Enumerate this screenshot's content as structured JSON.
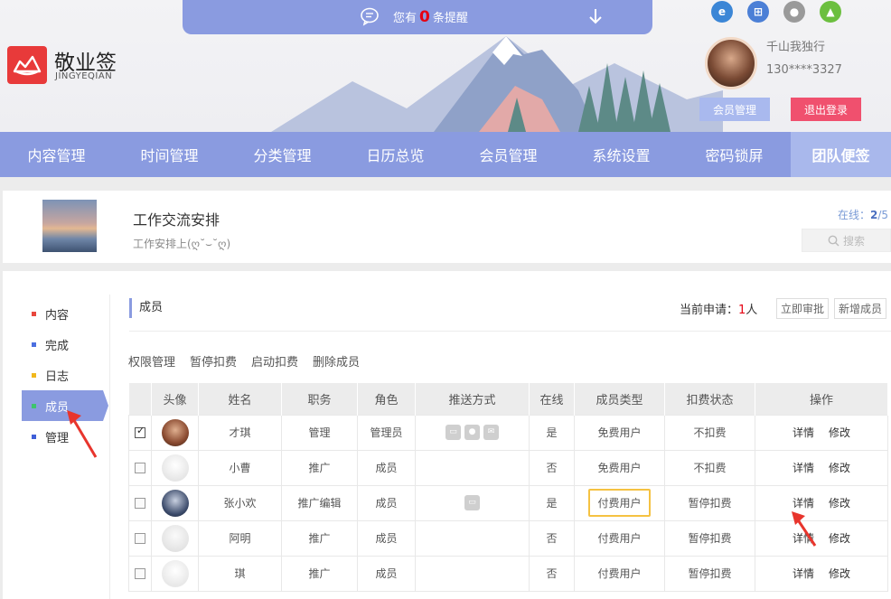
{
  "notice": {
    "prefix": "您有",
    "count": "0",
    "suffix": "条提醒"
  },
  "brand": {
    "name": "敬业签",
    "en": "JINGYEQIAN"
  },
  "browser_icons": [
    "ie-icon",
    "windows-icon",
    "apple-icon",
    "android-icon"
  ],
  "user": {
    "name": "千山我独行",
    "phone": "130****3327"
  },
  "header_buttons": {
    "member": "会员管理",
    "logout": "退出登录"
  },
  "nav": [
    "内容管理",
    "时间管理",
    "分类管理",
    "日历总览",
    "会员管理",
    "系统设置",
    "密码锁屏",
    "团队便签"
  ],
  "group": {
    "title": "工作交流安排",
    "desc": "工作安排上(ღ˘⌣˘ღ)",
    "online_label": "在线：",
    "online_now": "2",
    "online_sep": "/",
    "online_total": "5",
    "search_placeholder": "搜索"
  },
  "sidebar": [
    {
      "label": "内容",
      "color": "#e8473d"
    },
    {
      "label": "完成",
      "color": "#4b6fe0"
    },
    {
      "label": "日志",
      "color": "#f1b81c"
    },
    {
      "label": "成员",
      "color": "#3ec46d"
    },
    {
      "label": "管理",
      "color": "#3f5fd8"
    }
  ],
  "section": {
    "title": "成员",
    "apply_label": "当前申请：",
    "apply_count": "1",
    "apply_unit": "人",
    "btn_review": "立即审批",
    "btn_add": "新增成员"
  },
  "ops": [
    "权限管理",
    "暂停扣费",
    "启动扣费",
    "删除成员"
  ],
  "table": {
    "headers": [
      "",
      "头像",
      "姓名",
      "职务",
      "角色",
      "推送方式",
      "在线",
      "成员类型",
      "扣费状态",
      "操作"
    ],
    "detail_label": "详情",
    "edit_label": "修改",
    "rows": [
      {
        "checked": true,
        "name": "才琪",
        "title": "管理",
        "role": "管理员",
        "online": "是",
        "type": "免费用户",
        "fee": "不扣费"
      },
      {
        "checked": false,
        "name": "小曹",
        "title": "推广",
        "role": "成员",
        "online": "否",
        "type": "免费用户",
        "fee": "不扣费"
      },
      {
        "checked": false,
        "name": "张小欢",
        "title": "推广编辑",
        "role": "成员",
        "online": "是",
        "type": "付费用户",
        "fee": "暂停扣费"
      },
      {
        "checked": false,
        "name": "阿明",
        "title": "推广",
        "role": "成员",
        "online": "否",
        "type": "付费用户",
        "fee": "暂停扣费"
      },
      {
        "checked": false,
        "name": "琪",
        "title": "推广",
        "role": "成员",
        "online": "否",
        "type": "付费用户",
        "fee": "暂停扣费"
      }
    ]
  },
  "colors": {
    "accent": "#8a9be0",
    "logout": "#f0506e",
    "highlight": "#f5c242",
    "alert": "#e60012"
  }
}
